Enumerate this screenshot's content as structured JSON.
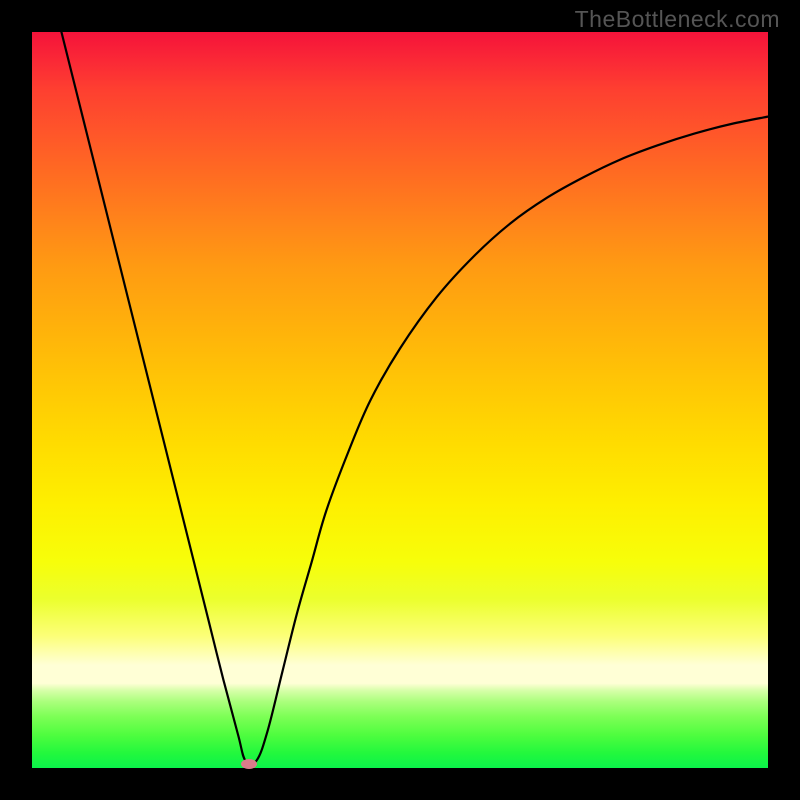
{
  "watermark": "TheBottleneck.com",
  "chart_data": {
    "type": "line",
    "title": "",
    "xlabel": "",
    "ylabel": "",
    "xlim": [
      0,
      100
    ],
    "ylim": [
      0,
      100
    ],
    "background_gradient": {
      "direction": "vertical",
      "stops": [
        {
          "pos": 0,
          "color": "#f5133a"
        },
        {
          "pos": 50,
          "color": "#ffdc00"
        },
        {
          "pos": 86,
          "color": "#ffffd6"
        },
        {
          "pos": 100,
          "color": "#0bf24a"
        }
      ]
    },
    "series": [
      {
        "name": "bottleneck-curve",
        "color": "#000000",
        "x": [
          4.0,
          6.0,
          8.0,
          10.0,
          12.0,
          14.0,
          16.0,
          18.0,
          20.0,
          22.0,
          24.0,
          26.0,
          28.0,
          29.0,
          30.5,
          32.0,
          34.0,
          36.0,
          38.0,
          40.0,
          43.0,
          46.0,
          50.0,
          55.0,
          60.0,
          65.0,
          70.0,
          75.0,
          80.0,
          85.0,
          90.0,
          95.0,
          100.0
        ],
        "y": [
          100.0,
          92.0,
          84.0,
          76.0,
          68.0,
          60.0,
          52.0,
          44.0,
          36.0,
          28.0,
          20.0,
          12.0,
          4.5,
          1.0,
          1.0,
          5.0,
          13.0,
          21.0,
          28.0,
          35.0,
          43.0,
          50.0,
          57.0,
          64.0,
          69.5,
          74.0,
          77.5,
          80.3,
          82.7,
          84.6,
          86.2,
          87.5,
          88.5
        ]
      }
    ],
    "marker": {
      "name": "optimum-dot",
      "x": 29.5,
      "y": 0.5,
      "color": "#d97b8a"
    }
  }
}
